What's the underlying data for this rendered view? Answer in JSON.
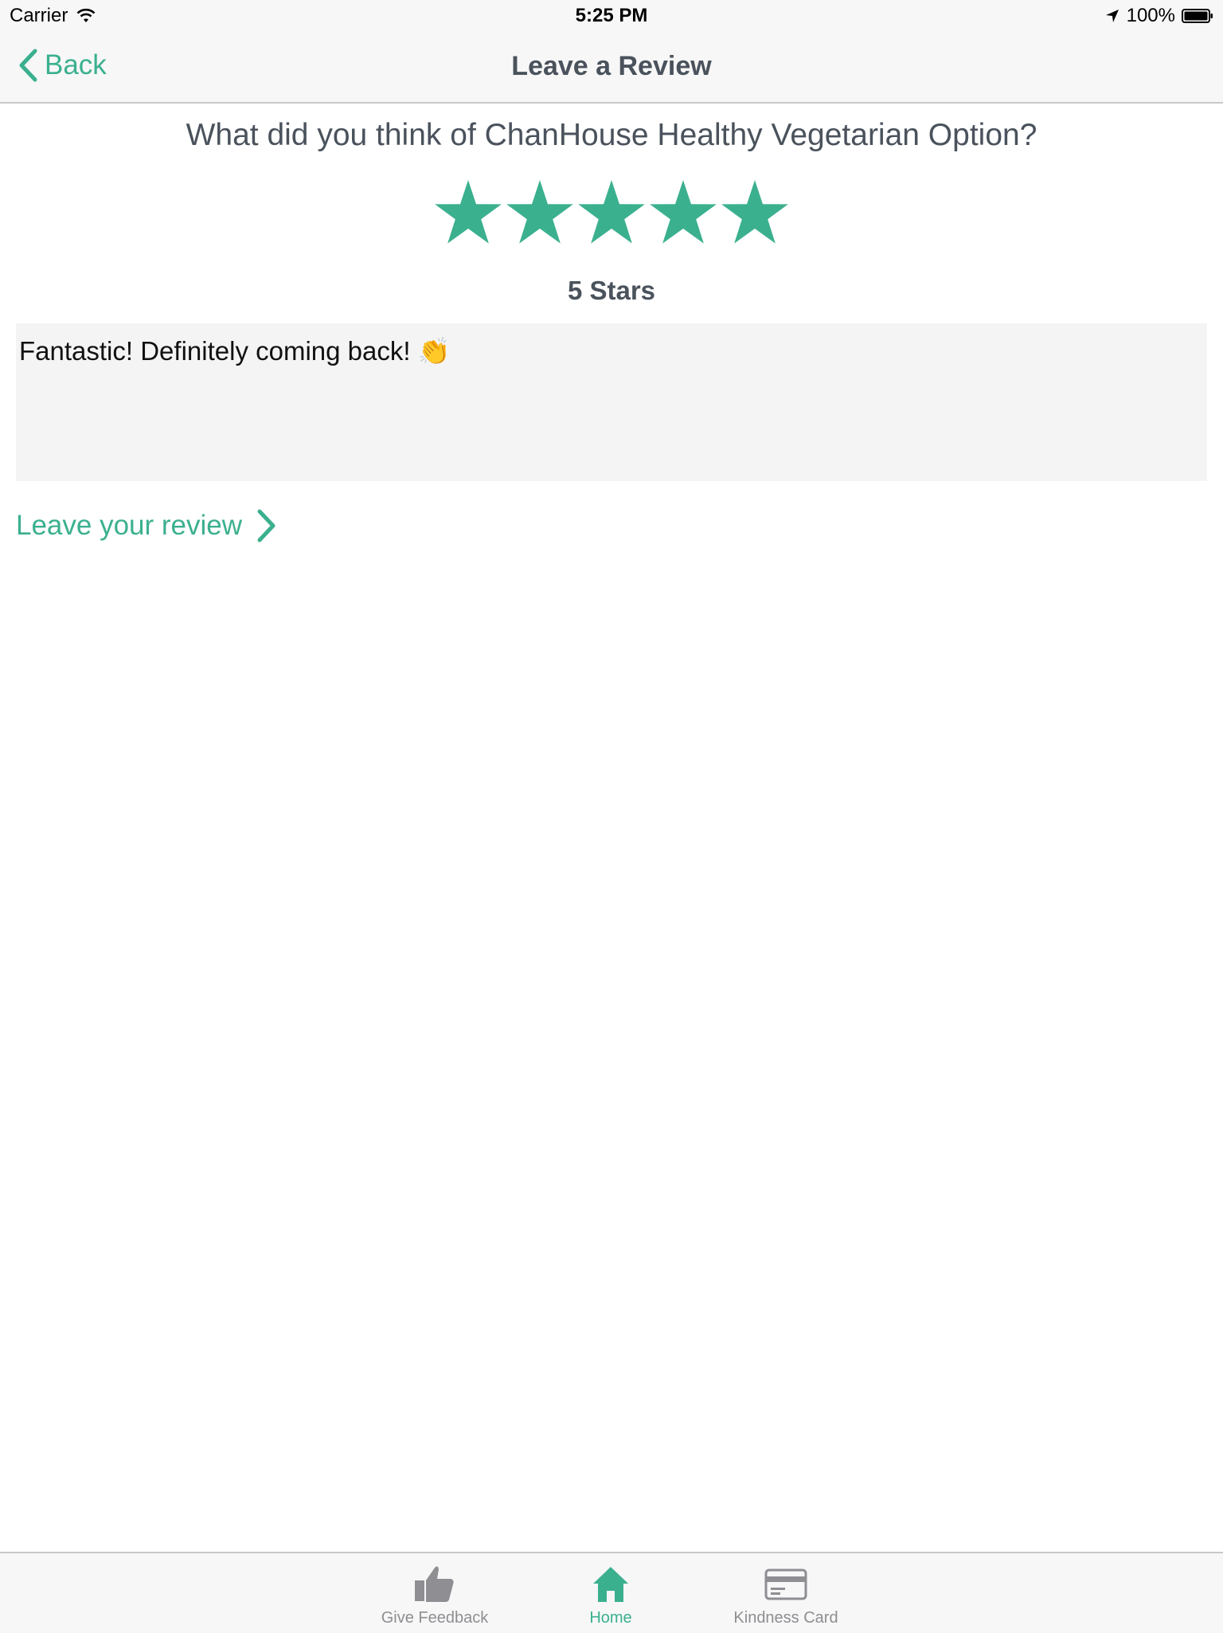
{
  "status_bar": {
    "carrier": "Carrier",
    "time": "5:25 PM",
    "battery": "100%"
  },
  "nav": {
    "back_label": "Back",
    "title": "Leave a Review"
  },
  "review": {
    "question": "What did you think of ChanHouse Healthy Vegetarian Option?",
    "rating": 5,
    "rating_max": 5,
    "rating_label": "5 Stars",
    "text": "Fantastic! Definitely coming back! 👏",
    "submit_label": "Leave your review"
  },
  "tabs": [
    {
      "label": "Give Feedback",
      "icon": "thumbs-up-icon",
      "active": false
    },
    {
      "label": "Home",
      "icon": "home-icon",
      "active": true
    },
    {
      "label": "Kindness Card",
      "icon": "card-icon",
      "active": false
    }
  ],
  "colors": {
    "accent": "#3bb08f",
    "title_text": "#4a525c",
    "inactive_tab": "#8e8e93",
    "bar_background": "#f7f7f7",
    "text_area_background": "#f4f4f4"
  }
}
